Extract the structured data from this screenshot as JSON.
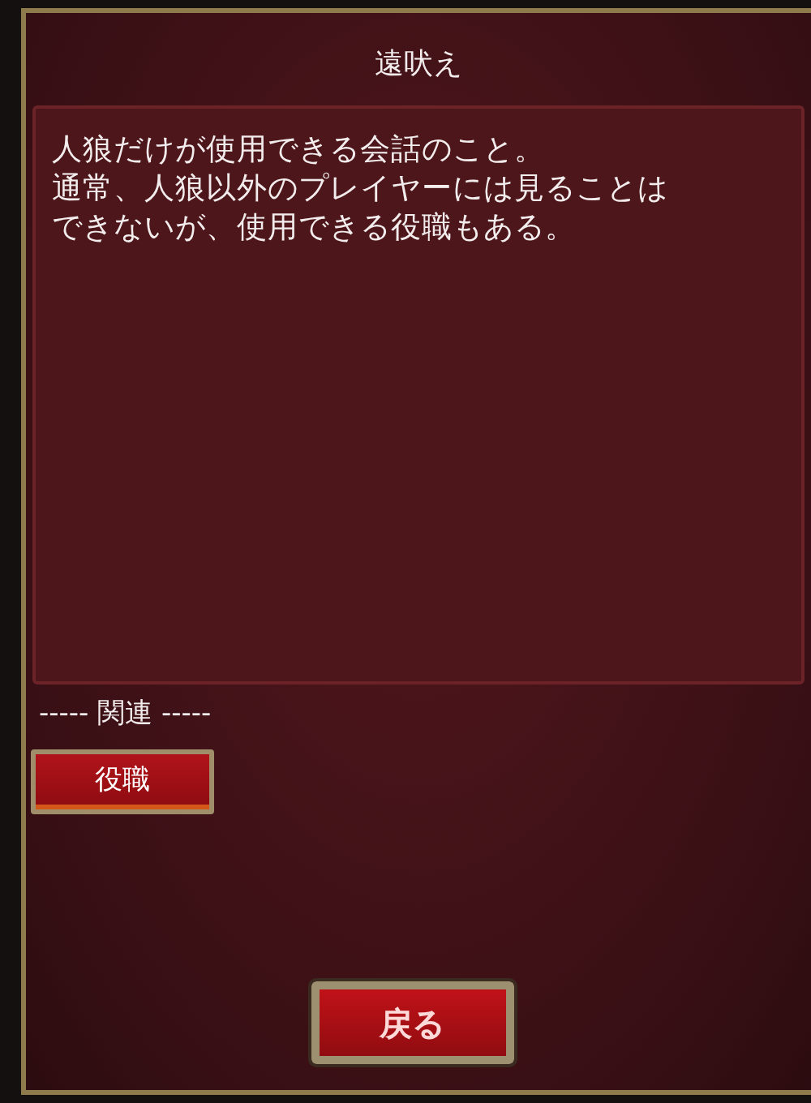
{
  "dialog": {
    "title": "遠吠え",
    "description_lines": [
      "人狼だけが使用できる会話のこと。",
      "通常、人狼以外のプレイヤーには見ることは",
      "できないが、使用できる役職もある。"
    ],
    "related_heading": "----- 関連 -----",
    "related_links": [
      {
        "label": "役職"
      }
    ],
    "back_button": "戻る"
  }
}
